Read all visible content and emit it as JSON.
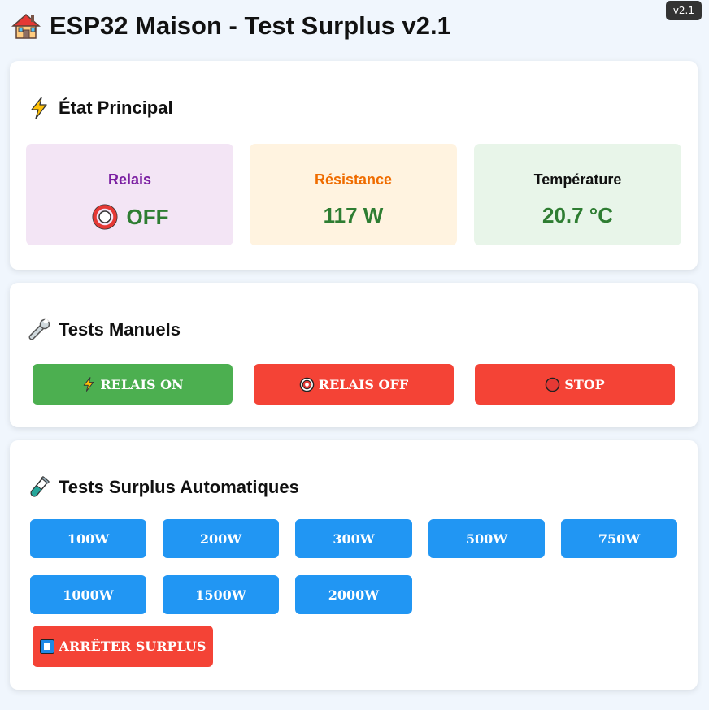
{
  "app": {
    "title": "ESP32 Maison - Test Surplus v2.1",
    "version": "v2.1",
    "title_icon": "house-icon"
  },
  "etat": {
    "title": "État Principal",
    "icon": "lightning-icon",
    "relais": {
      "label": "Relais",
      "value": "OFF",
      "icon": "red-circle-icon",
      "label_color": "#7b1fa2",
      "bg": "#f3e5f5"
    },
    "resistance": {
      "label": "Résistance",
      "value": "117 W",
      "label_color": "#ef6c00",
      "bg": "#fff3e0"
    },
    "temperature": {
      "label": "Température",
      "value": "20.7 °C",
      "label_color": "#111111",
      "bg": "#e8f5e9"
    },
    "value_color": "#2e7d32"
  },
  "manuel": {
    "title": "Tests Manuels",
    "icon": "wrench-icon",
    "buttons": [
      {
        "label": "RELAIS ON",
        "icon": "lightning-icon",
        "color": "#4caf50"
      },
      {
        "label": "RELAIS OFF",
        "icon": "radio-button-icon",
        "color": "#f44336"
      },
      {
        "label": "STOP",
        "icon": "red-circle-icon",
        "color": "#f44336"
      }
    ]
  },
  "surplus": {
    "title": "Tests Surplus Automatiques",
    "icon": "test-tube-icon",
    "buttons": [
      "100W",
      "200W",
      "300W",
      "500W",
      "750W",
      "1000W",
      "1500W",
      "2000W"
    ],
    "stop_label": "ARRÊTER SURPLUS",
    "stop_icon": "stop-square-icon",
    "button_color": "#2196f3"
  }
}
